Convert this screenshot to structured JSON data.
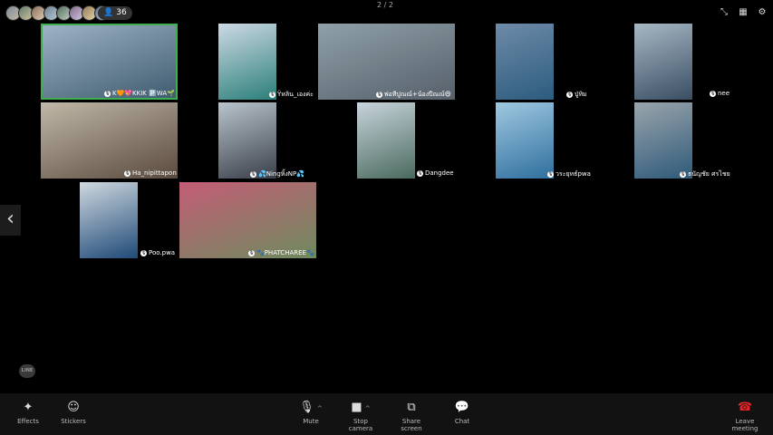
{
  "header": {
    "participant_count": "36",
    "page_indicator": "2 / 2"
  },
  "tiles": [
    {
      "name": "K🧡💖KKIK 🅿️WA🌱",
      "active": true,
      "colors": [
        "#9fb4c8",
        "#3e5a6e"
      ]
    },
    {
      "name": "Ÿหลิน_เองค่ะ",
      "active": false,
      "colors": [
        "#cdd9e4",
        "#2b7f7a"
      ]
    },
    {
      "name": "พ่อทีปูณณ์+น้องปีณณ์😄",
      "active": false,
      "colors": [
        "#8fa0a8",
        "#56606a"
      ]
    },
    {
      "name": "ปู่ทิม",
      "active": false,
      "colors": [
        "#6e8aa8",
        "#2c5c7e"
      ]
    },
    {
      "name": "nee",
      "active": false,
      "colors": [
        "#a7b8c4",
        "#3a4e63"
      ]
    },
    {
      "name": "Ha_nipittapon",
      "active": false,
      "colors": [
        "#c0b8a8",
        "#5a4a3e"
      ]
    },
    {
      "name": "💦Ningหิ้งNP💦",
      "active": false,
      "colors": [
        "#b9c4cc",
        "#3a3f4a"
      ]
    },
    {
      "name": "Dangdee",
      "active": false,
      "colors": [
        "#c8d4dc",
        "#4a6a5e"
      ]
    },
    {
      "name": "วระยุทธ์pwa",
      "active": false,
      "colors": [
        "#9fc8e0",
        "#2f6f9e"
      ]
    },
    {
      "name": "ธนัญชัย ศรไชย",
      "active": false,
      "colors": [
        "#9aa4ab",
        "#2e5a7a"
      ]
    },
    {
      "name": "Poo.pwa",
      "active": false,
      "colors": [
        "#cfd8df",
        "#1f4a78"
      ]
    },
    {
      "name": "🐾PHATCHAREE🐾",
      "active": false,
      "colors": [
        "#c45d76",
        "#6e8a5e"
      ]
    }
  ],
  "toolbar": {
    "effects": "Effects",
    "stickers": "Stickers",
    "mute": "Mute",
    "stop_camera": "Stop camera",
    "share_screen": "Share screen",
    "chat": "Chat",
    "leave": "Leave meeting"
  },
  "logo": "LINE"
}
